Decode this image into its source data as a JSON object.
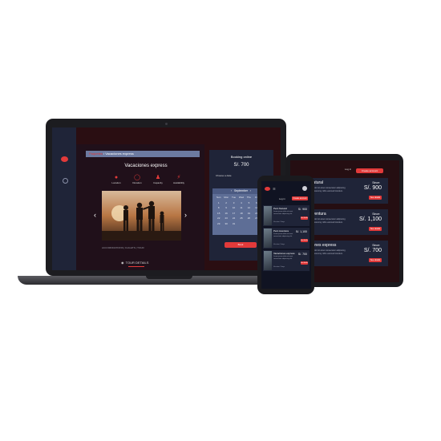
{
  "laptop": {
    "breadcrumb_parent": "Paquetes",
    "breadcrumb_sep": "/",
    "breadcrumb_current": "Vacaciones express",
    "title": "Vacaciones express",
    "features": [
      {
        "icon": "location-pin-icon",
        "label": "Location"
      },
      {
        "icon": "timer-icon",
        "label": "Duration"
      },
      {
        "icon": "people-icon",
        "label": "Capacity"
      },
      {
        "icon": "lightning-icon",
        "label": "Availability"
      }
    ],
    "tabs": [
      "ACCOMODATIONS",
      "|",
      "FLIGHTS",
      "|",
      "TOUR"
    ],
    "tour_details_label": "TOUR DETAILS",
    "booking": {
      "title": "Booking online",
      "price": "S/. 700",
      "subtitle": "Choose a date",
      "month": "September",
      "weekdays": [
        "Sun",
        "Mon",
        "Tue",
        "Wed",
        "Thu",
        "Fri",
        "Sat"
      ],
      "days": [
        "1",
        "2",
        "3",
        "4",
        "5",
        "6",
        "7",
        "8",
        "9",
        "10",
        "11",
        "12",
        "13",
        "14",
        "15",
        "16",
        "17",
        "18",
        "19",
        "20",
        "21",
        "22",
        "23",
        "24",
        "25",
        "26",
        "27",
        "28",
        "29",
        "30",
        "31"
      ],
      "button": "Book"
    }
  },
  "tablet": {
    "login": "Log in",
    "cta": "Create account",
    "cards": [
      {
        "title": "Perú Natural",
        "description": "Lorem ipsum dolor sit amet consectetur adipiscing elit, sed diam nonummy nibh euismod tincidunt.",
        "since": "Since:",
        "price": "S/. 900",
        "button": "See details",
        "meta": "Vacation 3 days"
      },
      {
        "title": "Perú Aventura",
        "description": "Lorem ipsum dolor sit amet consectetur adipiscing elit, sed diam nonummy nibh euismod tincidunt.",
        "since": "Since:",
        "price": "S/. 1,100",
        "button": "See details",
        "meta": "Vacation 5 days"
      },
      {
        "title": "Vacaciones express",
        "description": "Lorem ipsum dolor sit amet consectetur adipiscing elit, sed diam nonummy nibh euismod tincidunt.",
        "since": "Since:",
        "price": "S/. 700",
        "button": "See details",
        "meta": "Vacation 2 days"
      }
    ]
  },
  "phone": {
    "login": "Log in",
    "cta": "Create account",
    "cards": [
      {
        "title": "Perú Natural",
        "description": "Lorem ipsum dolor sit amet consectetur adipiscing elit.",
        "price": "S/. 900",
        "button": "See details",
        "meta": "Vacation 3 days"
      },
      {
        "title": "Perú Aventura",
        "description": "Lorem ipsum dolor sit amet consectetur adipiscing elit.",
        "price": "S/. 1,100",
        "button": "See details",
        "meta": "Vacation 5 days"
      },
      {
        "title": "Vacaciones express",
        "description": "Lorem ipsum dolor sit amet consectetur adipiscing elit.",
        "price": "S/. 700",
        "button": "See details",
        "meta": "Vacation 2 days"
      }
    ]
  },
  "colors": {
    "accent": "#e23a3a",
    "panel": "#1f2438",
    "background": "#2a0e12"
  }
}
